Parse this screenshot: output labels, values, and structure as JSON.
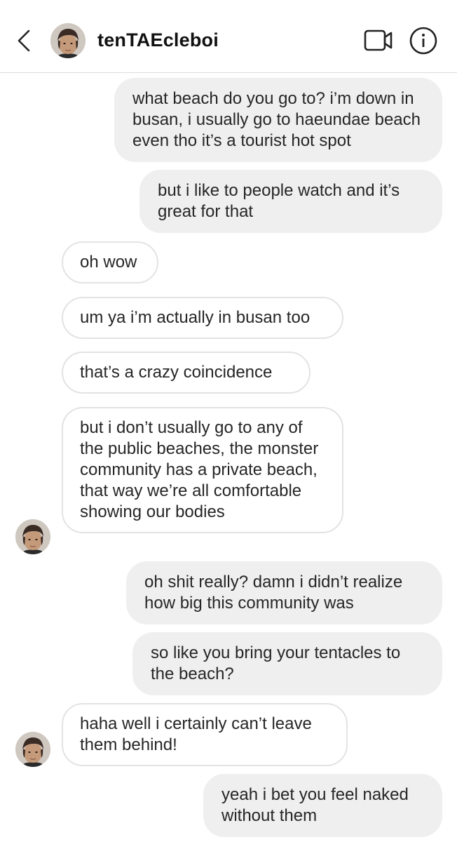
{
  "header": {
    "username": "tenTAEcleboi",
    "back_icon": "chevron-left-icon",
    "video_icon": "video-camera-icon",
    "info_icon": "info-icon"
  },
  "messages": [
    {
      "sender": "me",
      "text": "what beach do you go to? i’m down in busan, i usually go to haeundae beach even tho it’s a tourist hot spot"
    },
    {
      "sender": "me",
      "text": "but i like to people watch and it’s great for that"
    },
    {
      "sender": "them",
      "text": "oh wow"
    },
    {
      "sender": "them",
      "text": "um ya i’m actually in busan too"
    },
    {
      "sender": "them",
      "text": "that’s a crazy coincidence"
    },
    {
      "sender": "them",
      "text": "but i don’t usually go to any of the public beaches, the monster community has a private beach, that way we’re all comfortable showing our bodies"
    },
    {
      "sender": "me",
      "text": "oh shit really? damn i didn’t realize how big this community was"
    },
    {
      "sender": "me",
      "text": "so like you bring your tentacles to the beach?"
    },
    {
      "sender": "them",
      "text": "haha well i certainly can’t leave them behind!"
    },
    {
      "sender": "me",
      "text": "yeah i bet you feel naked without them"
    }
  ],
  "colors": {
    "sent_bubble": "#efefef",
    "received_border": "#e3e3e3",
    "text": "#262626"
  }
}
